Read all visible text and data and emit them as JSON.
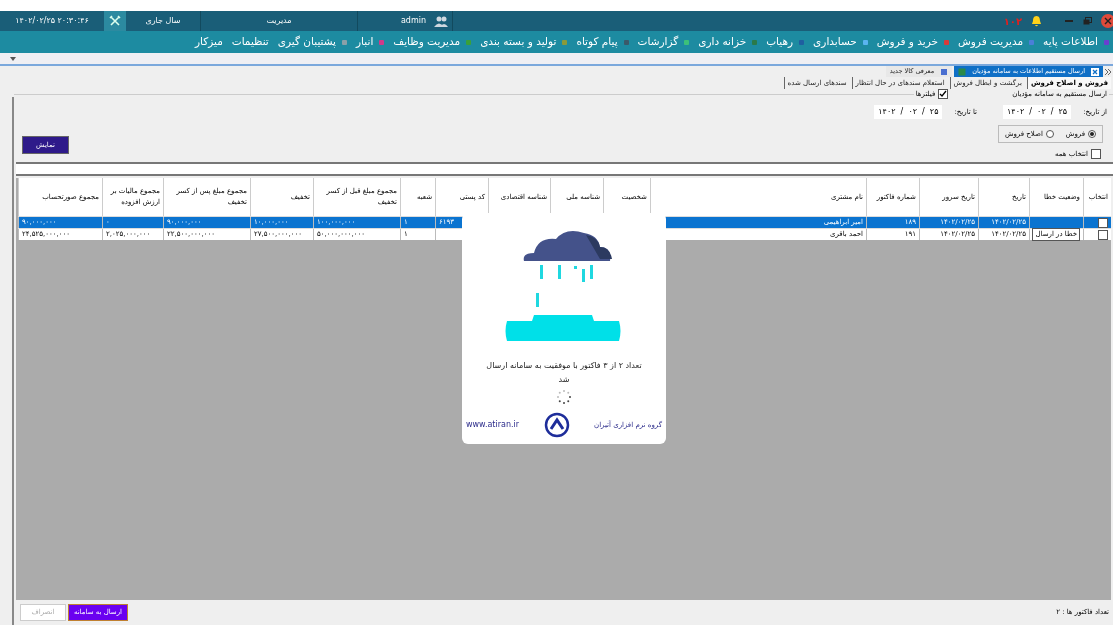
{
  "title_bar": {
    "datetime": "۱۴۰۲/۰۲/۲۵  ۲۰:۳۰:۴۶",
    "fiscal_year": "سال جاری",
    "role": "مدیریت",
    "user": "admin",
    "notification_count": "۱۰۲"
  },
  "menu": [
    {
      "label": "اطلاعات پایه",
      "color": "#6a3fd0"
    },
    {
      "label": "مدیریت فروش",
      "color": "#4a7fd8"
    },
    {
      "label": "خرید و فروش",
      "color": "#d83a3a"
    },
    {
      "label": "حسابداری",
      "color": "#5ab4f0"
    },
    {
      "label": "رهیاب",
      "color": "#1f5fa0"
    },
    {
      "label": "خزانه داری",
      "color": "#2a7a4a"
    },
    {
      "label": "گزارشات",
      "color": "#3cc07a"
    },
    {
      "label": "پیام کوتاه",
      "color": "#3a5a6a"
    },
    {
      "label": "تولید و بسته بندی",
      "color": "#8a9a3a"
    },
    {
      "label": "مدیریت وظایف",
      "color": "#3aa03a"
    },
    {
      "label": "انبار",
      "color": "#d03a8a"
    },
    {
      "label": "پشتیبان گیری",
      "color": "#8aa0a8"
    },
    {
      "label": "تنظیمات"
    },
    {
      "label": "میزکار"
    }
  ],
  "doc_tabs": [
    {
      "label": "ارسال مستقیم اطلاعات به سامانه مؤدیان",
      "selected": true
    },
    {
      "label": "معرفی کالا جدید",
      "selected": false
    }
  ],
  "sub_tabs": [
    {
      "label": "فروش و اصلاح فروش",
      "selected": true
    },
    {
      "label": "برگشت و ابطال فروش",
      "selected": false
    },
    {
      "label": "استعلام سندهای در حال انتظار",
      "selected": false
    },
    {
      "label": "سندهای ارسال شده",
      "selected": false
    }
  ],
  "group_title": "ارسال مستقیم به سامانه مؤدیان",
  "filters": {
    "label": "فیلترها",
    "checked": true,
    "date_separator": "/",
    "from_label": "از تاریخ:",
    "from_date": [
      "۲۵",
      "۰۲",
      "۱۴۰۲"
    ],
    "to_label": "تا تاریخ:",
    "to_date": [
      "۲۵",
      "۰۲",
      "۱۴۰۲"
    ],
    "radios": [
      {
        "label": "فروش",
        "selected": true
      },
      {
        "label": "اصلاح فروش",
        "selected": false
      }
    ],
    "select_all": {
      "label": "انتخاب همه",
      "checked": false
    },
    "show_button": "نمایش"
  },
  "table": {
    "columns": [
      "انتخاب",
      "وضعیت خطا",
      "تاریخ",
      "تاریخ سرور",
      "شماره فاکتور",
      "نام مشتری",
      "شخصیت",
      "شناسه ملی",
      "شناسه اقتصادی",
      "کد پستی",
      "شعبه",
      "مجموع مبلغ قبل از کسر تخفیف",
      "تخفیف",
      "مجموع مبلغ پس از کسر تخفیف",
      "مجموع مالیات بر ارزش افزوده",
      "مجموع صورتحساب"
    ],
    "rows": [
      {
        "selected": true,
        "checked": false,
        "cells": [
          null,
          null,
          "۱۴۰۲/۰۲/۲۵",
          "۱۴۰۲/۰۲/۲۵",
          "۱۸۹",
          "امیر ابراهیمی",
          null,
          null,
          null,
          "۶۱۹۳",
          "۱",
          "۱۰۰,۰۰۰,۰۰۰",
          "۱۰,۰۰۰,۰۰۰",
          "۹۰,۰۰۰,۰۰۰",
          "۰",
          "۹۰,۰۰۰,۰۰۰"
        ]
      },
      {
        "selected": false,
        "checked": false,
        "cells": [
          null,
          "خطا در ارسال",
          "۱۴۰۲/۰۲/۲۵",
          "۱۴۰۲/۰۲/۲۵",
          "۱۹۱",
          "احمد باقری",
          null,
          null,
          null,
          null,
          "۱",
          "۵۰,۰۰۰,۰۰۰,۰۰۰",
          "۲۷,۵۰۰,۰۰۰,۰۰۰",
          "۲۲,۵۰۰,۰۰۰,۰۰۰",
          "۲,۰۲۵,۰۰۰,۰۰۰",
          "۲۴,۵۲۵,۰۰۰,۰۰۰"
        ]
      }
    ]
  },
  "dialog": {
    "message": "تعداد ۲ از ۳ فاکتور با موفقیت به سامانه ارسال شد",
    "company": "گروه نرم افزاری آتیران",
    "website": "www.atiran.ir"
  },
  "footer": {
    "send_button": "ارسال به سامانه",
    "cancel_button": {
      "label": "انصراف",
      "disabled": true
    },
    "count": "تعداد فاکتور ها : ۲"
  }
}
